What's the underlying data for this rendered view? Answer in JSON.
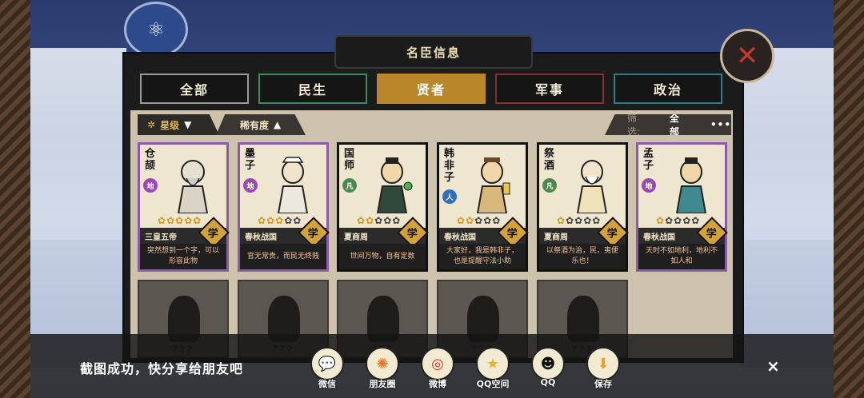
{
  "panel": {
    "title": "名臣信息"
  },
  "tabs": [
    {
      "label": "全部"
    },
    {
      "label": "民生"
    },
    {
      "label": "贤者",
      "selected": true
    },
    {
      "label": "军事"
    },
    {
      "label": "政治"
    }
  ],
  "filters": {
    "star_label": "星级",
    "rarity_label": "稀有度",
    "screen_label": "筛选:",
    "screen_value": "全部",
    "more": "•••"
  },
  "cards": [
    {
      "name": "仓颉",
      "grade": "地",
      "stars_filled": 5,
      "era": "三皇五帝",
      "category": "学",
      "quote": "突然想到一个字，可以形容此物"
    },
    {
      "name": "墨子",
      "grade": "地",
      "stars_filled": 3,
      "era": "春秋战国",
      "category": "学",
      "quote": "官无常贵，而民无终贱"
    },
    {
      "name": "国师",
      "grade": "凡",
      "stars_filled": 2,
      "era": "夏商周",
      "category": "学",
      "quote": "世间万物，自有定数"
    },
    {
      "name": "韩非子",
      "grade": "人",
      "stars_filled": 2,
      "era": "春秋战国",
      "category": "学",
      "quote": "大家好，我是韩非子，也是提醒守法小助"
    },
    {
      "name": "祭酒",
      "grade": "凡",
      "stars_filled": 1,
      "era": "夏商周",
      "category": "学",
      "quote": "以祭酒为治，民，夷便乐也！"
    },
    {
      "name": "孟子",
      "grade": "地",
      "stars_filled": 1,
      "era": "春秋战国",
      "category": "学",
      "quote": "天时不如地利，地利不如人和"
    }
  ],
  "locked_cards": [
    {
      "label": "???"
    },
    {
      "label": "???"
    },
    {
      "label": "???"
    },
    {
      "label": "???"
    },
    {
      "label": "???"
    }
  ],
  "share": {
    "message": "截图成功，快分享给朋友吧",
    "items": [
      {
        "label": "微信",
        "icon": "wechat-icon"
      },
      {
        "label": "朋友圈",
        "icon": "moments-icon"
      },
      {
        "label": "微博",
        "icon": "weibo-icon"
      },
      {
        "label": "QQ空间",
        "icon": "qzone-icon"
      },
      {
        "label": "QQ",
        "icon": "qq-icon"
      },
      {
        "label": "保存",
        "icon": "download-icon"
      }
    ],
    "close": "×"
  },
  "colors": {
    "selected_tab": "#b9862a",
    "min_tab": "#3a8a63",
    "jun_tab": "#8a2f2f",
    "zheng_tab": "#2d7d86",
    "rare_border": "#8b5aa8",
    "star": "#d39a28"
  }
}
